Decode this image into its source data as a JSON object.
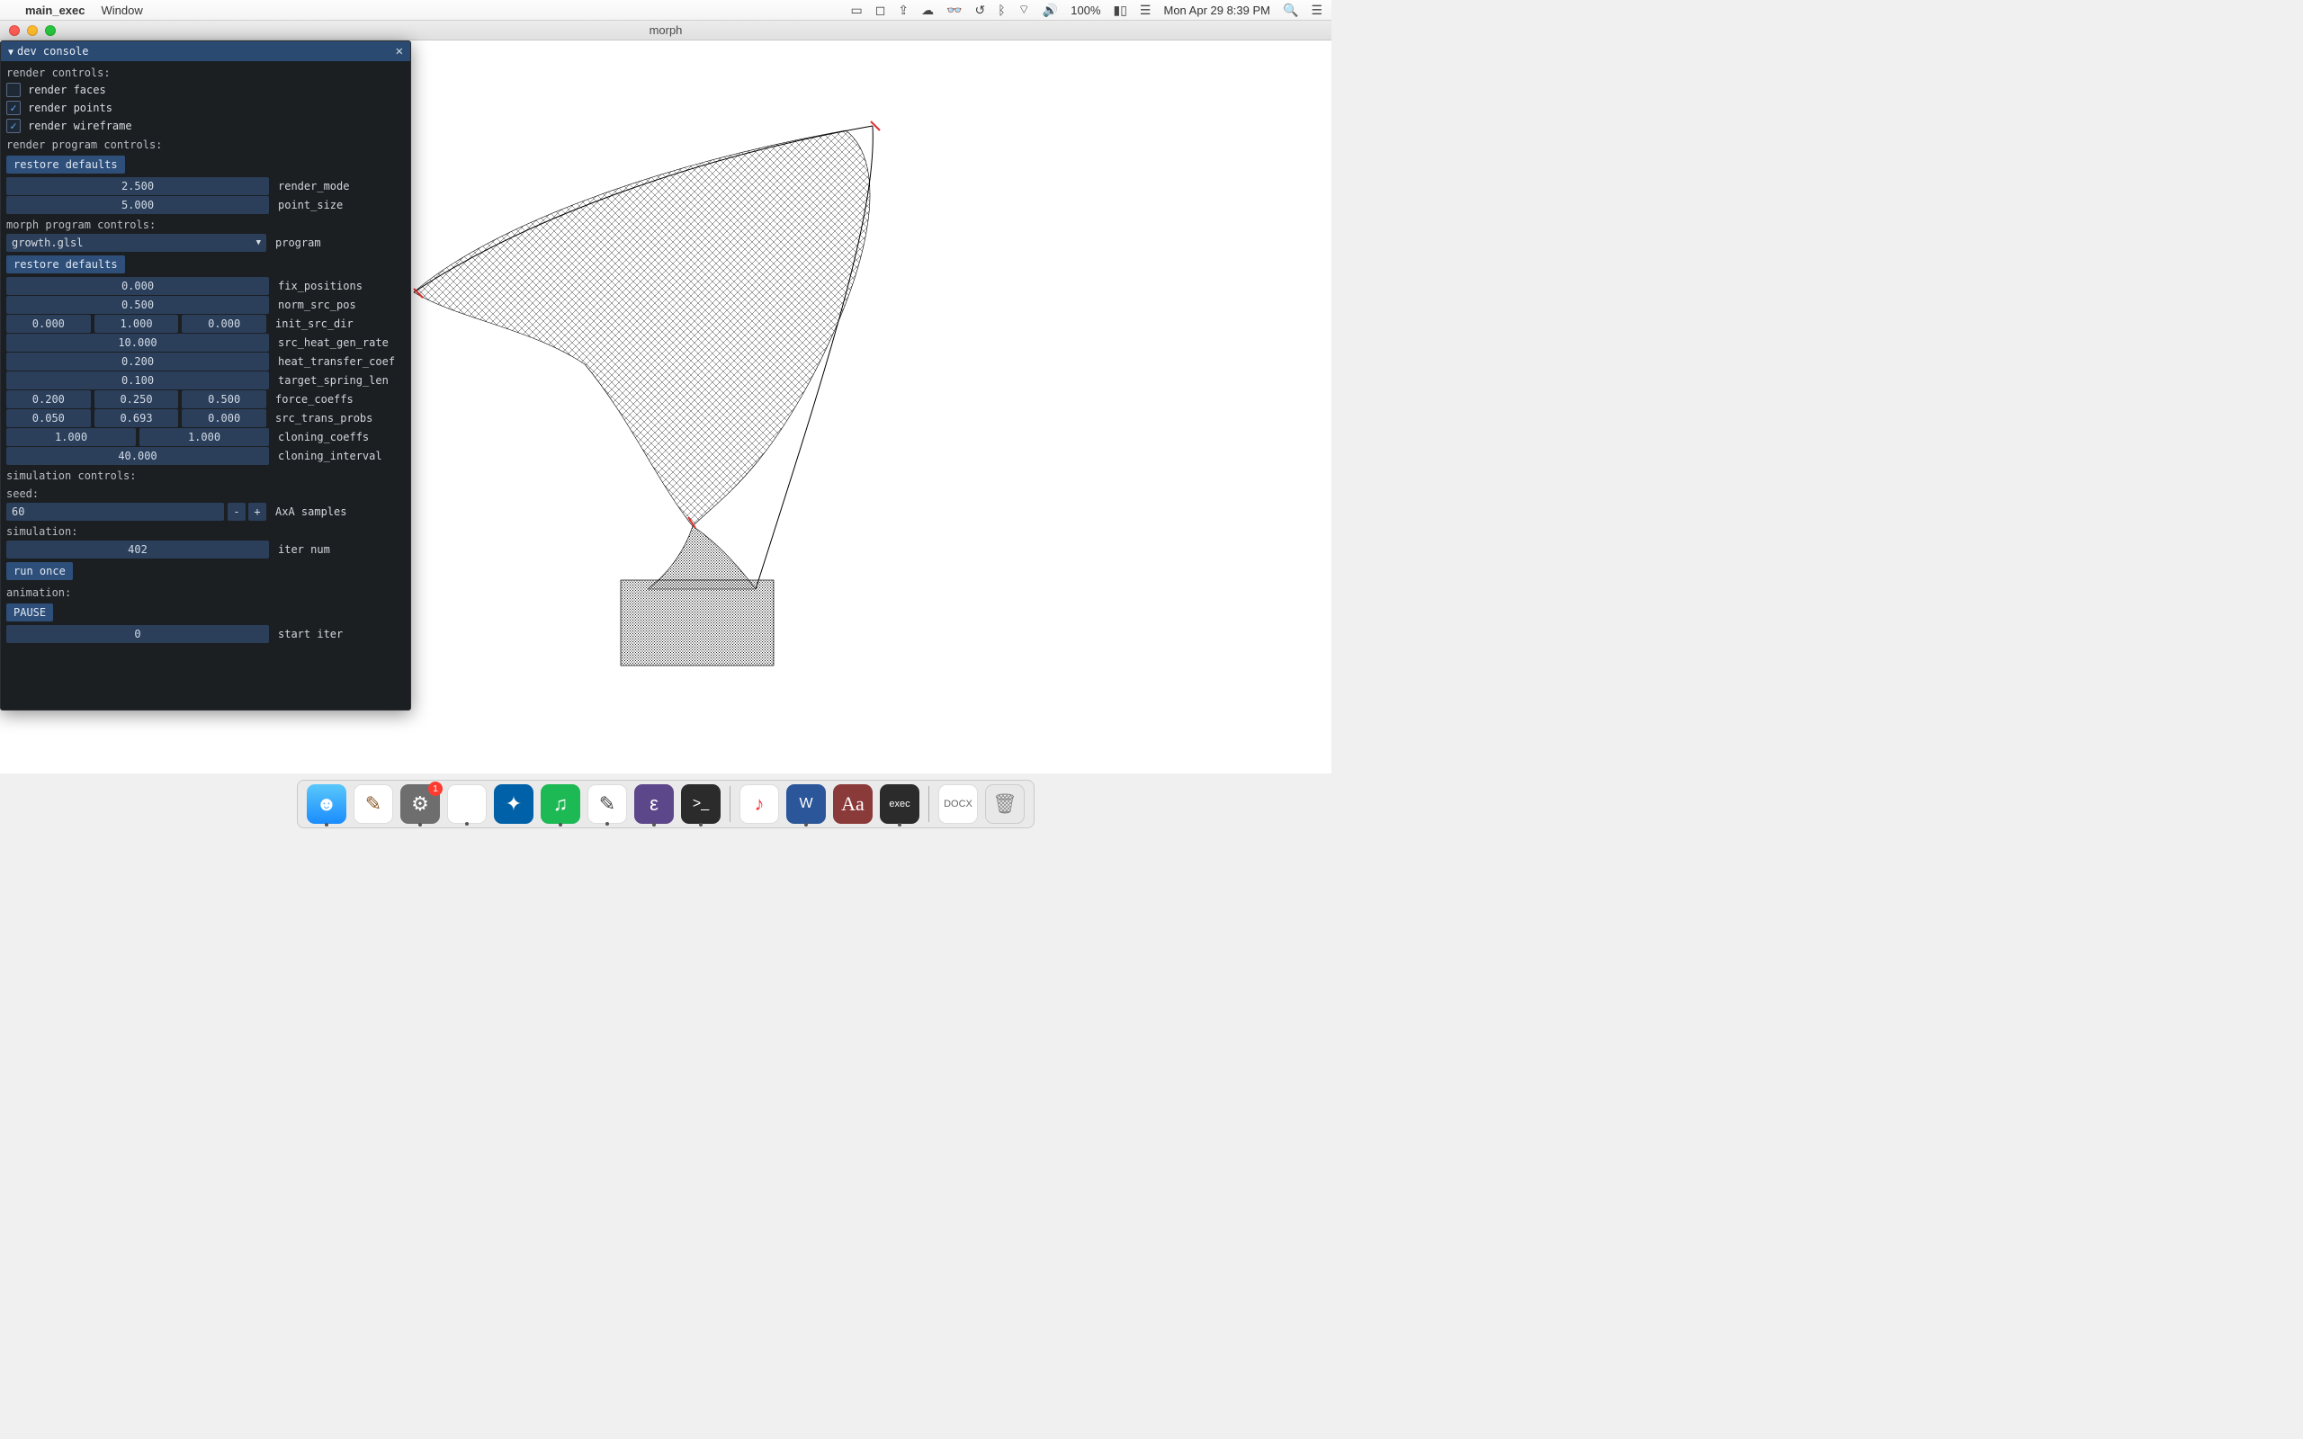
{
  "menubar": {
    "app_name": "main_exec",
    "menus": [
      "Window"
    ],
    "battery_pct": "100%",
    "datetime": "Mon Apr 29  8:39 PM"
  },
  "window": {
    "title": "morph"
  },
  "dev_console": {
    "title": "dev console",
    "render_controls_label": "render controls:",
    "checks": {
      "render_faces": {
        "label": "render faces",
        "checked": false
      },
      "render_points": {
        "label": "render points",
        "checked": true
      },
      "render_wireframe": {
        "label": "render wireframe",
        "checked": true
      }
    },
    "render_program_controls_label": "render program controls:",
    "restore_defaults_label": "restore defaults",
    "render_params": {
      "render_mode": {
        "value": "2.500",
        "label": "render_mode"
      },
      "point_size": {
        "value": "5.000",
        "label": "point_size"
      }
    },
    "morph_program_controls_label": "morph program controls:",
    "program_dropdown": {
      "value": "growth.glsl",
      "label": "program"
    },
    "morph_params": {
      "fix_positions": {
        "values": [
          "0.000"
        ],
        "label": "fix_positions"
      },
      "norm_src_pos": {
        "values": [
          "0.500"
        ],
        "label": "norm_src_pos"
      },
      "init_src_dir": {
        "values": [
          "0.000",
          "1.000",
          "0.000"
        ],
        "label": "init_src_dir"
      },
      "src_heat_gen_rate": {
        "values": [
          "10.000"
        ],
        "label": "src_heat_gen_rate"
      },
      "heat_transfer_coef": {
        "values": [
          "0.200"
        ],
        "label": "heat_transfer_coef"
      },
      "target_spring_len": {
        "values": [
          "0.100"
        ],
        "label": "target_spring_len"
      },
      "force_coeffs": {
        "values": [
          "0.200",
          "0.250",
          "0.500"
        ],
        "label": "force_coeffs"
      },
      "src_trans_probs": {
        "values": [
          "0.050",
          "0.693",
          "0.000"
        ],
        "label": "src_trans_probs"
      },
      "cloning_coeffs": {
        "values": [
          "1.000",
          "1.000"
        ],
        "label": "cloning_coeffs",
        "span": 2
      },
      "cloning_interval": {
        "values": [
          "40.000"
        ],
        "label": "cloning_interval"
      }
    },
    "simulation_controls_label": "simulation controls:",
    "seed_label": "seed:",
    "axa_samples": {
      "value": "60",
      "label": "AxA samples"
    },
    "simulation_label": "simulation:",
    "iter_num": {
      "value": "402",
      "label": "iter num"
    },
    "run_once_label": "run once",
    "animation_label": "animation:",
    "pause_label": "PAUSE",
    "start_iter": {
      "value": "0",
      "label": "start iter"
    }
  },
  "dock": {
    "items": [
      {
        "name": "finder",
        "glyph": "☻",
        "running": true
      },
      {
        "name": "sketch",
        "glyph": "✎"
      },
      {
        "name": "settings",
        "glyph": "⚙",
        "badge": "1",
        "running": true
      },
      {
        "name": "chrome",
        "glyph": "◉",
        "running": true
      },
      {
        "name": "db",
        "glyph": "✦"
      },
      {
        "name": "spotify",
        "glyph": "♫",
        "running": true
      },
      {
        "name": "notes",
        "glyph": "✎",
        "running": true
      },
      {
        "name": "emacs",
        "glyph": "ε",
        "running": true
      },
      {
        "name": "term",
        "glyph": ">_",
        "running": true
      },
      {
        "name": "itunes",
        "glyph": "♪"
      },
      {
        "name": "word",
        "glyph": "W",
        "running": true
      },
      {
        "name": "dict",
        "glyph": "Aa"
      },
      {
        "name": "exec",
        "glyph": "exec",
        "running": true
      },
      {
        "name": "docx",
        "glyph": "DOCX"
      },
      {
        "name": "trash",
        "glyph": "🗑"
      }
    ]
  }
}
